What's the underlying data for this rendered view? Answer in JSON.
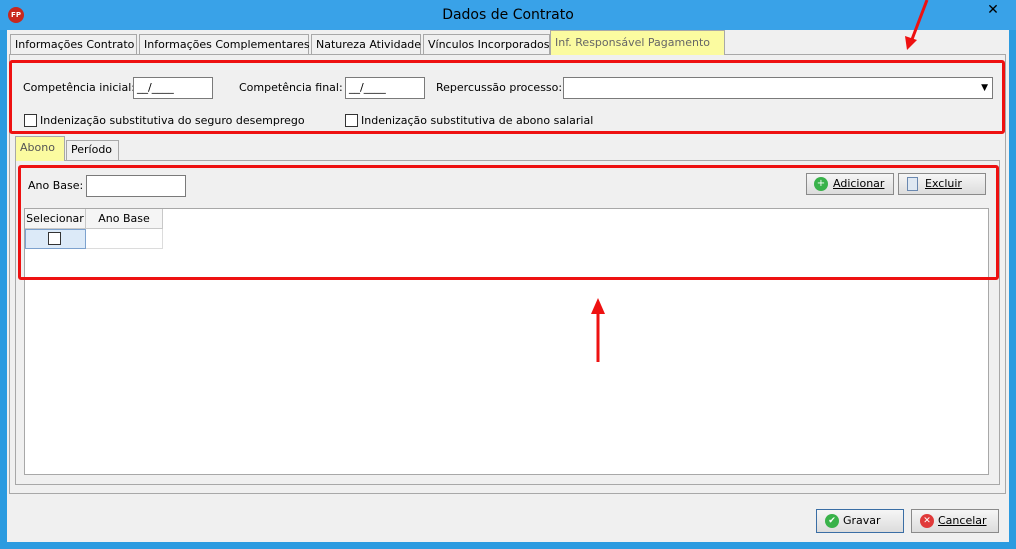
{
  "window": {
    "title": "Dados de Contrato",
    "app_icon": "FP",
    "close_glyph": "✕"
  },
  "tabs": [
    {
      "label": "Informações Contrato"
    },
    {
      "label": "Informações Complementares"
    },
    {
      "label": "Natureza Atividade"
    },
    {
      "label": "Vínculos Incorporados"
    },
    {
      "label": "Inf. Responsável Pagamento"
    }
  ],
  "form": {
    "competencia_inicial_label": "Competência inicial:",
    "competencia_inicial_value": "__/____",
    "competencia_final_label": "Competência final:",
    "competencia_final_value": "__/____",
    "repercussao_label": "Repercussão processo:",
    "repercussao_value": "",
    "chk_seguro_label": "Indenização substitutiva do seguro desemprego",
    "chk_abono_label": "Indenização substitutiva de abono salarial"
  },
  "subtabs": [
    {
      "label": "Abono"
    },
    {
      "label": "Período"
    }
  ],
  "abono": {
    "ano_base_label": "Ano Base:",
    "ano_base_value": "",
    "adicionar_label": "Adicionar",
    "excluir_label": "Excluir",
    "columns": [
      "Selecionar",
      "Ano Base"
    ]
  },
  "footer": {
    "gravar_label": "Gravar",
    "cancelar_label": "Cancelar"
  },
  "colors": {
    "highlight_tab": "#fbfba0",
    "annotation_red": "#ee1111"
  }
}
